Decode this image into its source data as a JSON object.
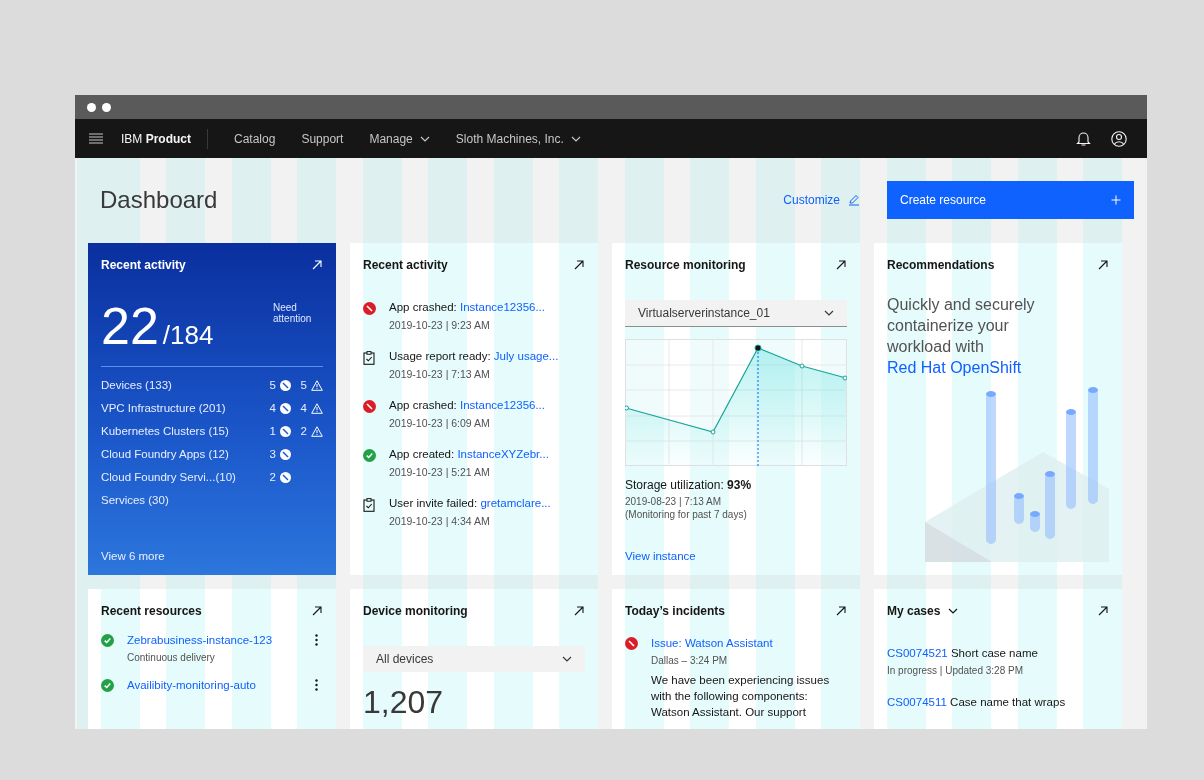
{
  "header": {
    "brand": "IBM **Product**",
    "nav": [
      {
        "label": "Catalog",
        "dropdown": false
      },
      {
        "label": "Support",
        "dropdown": false
      },
      {
        "label": "Manage",
        "dropdown": true
      },
      {
        "label": "Sloth Machines, Inc.",
        "dropdown": true
      }
    ]
  },
  "page": {
    "title": "Dashboard",
    "customize": "Customize",
    "create_button": "Create resource"
  },
  "cards": [
    {
      "kind": "summary",
      "title": "Recent activity",
      "count": "22",
      "total": "/184",
      "count_label": "Need attention",
      "rows": [
        {
          "label": "Devices (133)",
          "errors": "5",
          "warnings": "5"
        },
        {
          "label": "VPC Infrastructure (201)",
          "errors": "4",
          "warnings": "4"
        },
        {
          "label": "Kubernetes Clusters (15)",
          "errors": "1",
          "warnings": "2"
        },
        {
          "label": "Cloud Foundry Apps (12)",
          "errors": "3"
        },
        {
          "label": "Cloud Foundry Servi...(10)",
          "errors": "2"
        },
        {
          "label": "Services (30)"
        }
      ],
      "link": "View 6 more"
    },
    {
      "kind": "activity",
      "title": "Recent activity",
      "items": [
        {
          "kind": "error",
          "text": "App crashed:",
          "link": "Instance12356...",
          "time": "2019-10-23 |  9:23 AM"
        },
        {
          "kind": "report",
          "text": "Usage report ready:",
          "link": "July usage...",
          "time": "2019-10-23 |  7:13 AM"
        },
        {
          "kind": "error",
          "text": "App crashed:",
          "link": "Instance12356...",
          "time": "2019-10-23 |  6:09 AM"
        },
        {
          "kind": "success",
          "text": "App created:",
          "link": "InstanceXYZebr...",
          "time": "2019-10-23 |  5:21 AM"
        },
        {
          "kind": "report",
          "text": "User invite failed:",
          "link": "gretamclare...",
          "time": "2019-10-23 |  4:34 AM"
        }
      ]
    },
    {
      "kind": "monitoring",
      "title": "Resource monitoring",
      "dropdown": "Virtualserverinstance_01",
      "caption": "Storage utilization: **93%**",
      "date": "2019-08-23 |  7:13 AM",
      "note": "(Monitoring for past 7 days)",
      "link": "View instance"
    },
    {
      "kind": "recommendation",
      "title": "Recommendations",
      "text": "Quickly and securely containerize your workload with",
      "link": "Red Hat OpenShift"
    },
    {
      "kind": "resources",
      "title": "Recent resources",
      "items": [
        {
          "kind": "success",
          "name": "Zebrabusiness-instance-123",
          "sub": "Continuous delivery"
        },
        {
          "kind": "success",
          "name": "Availibity-monitoring-auto"
        }
      ]
    },
    {
      "kind": "devices",
      "title": "Device monitoring",
      "dropdown": "All devices",
      "count": "1,207"
    },
    {
      "kind": "incidents",
      "title": "Today’s incidents",
      "items": [
        {
          "kind": "error",
          "title": "Issue: Watson Assistant",
          "meta": "Dallas – 3:24 PM",
          "body": "We have been experiencing issues with the following components: Watson Assistant. Our support"
        }
      ]
    },
    {
      "kind": "cases",
      "title": "My cases",
      "title_dropdown": true,
      "items": [
        {
          "id": "CS0074521",
          "name": "Short case name",
          "meta": "In progress | Updated 3:28 PM"
        },
        {
          "id": "CS0074511",
          "name": "Case name that wraps"
        }
      ]
    }
  ]
}
